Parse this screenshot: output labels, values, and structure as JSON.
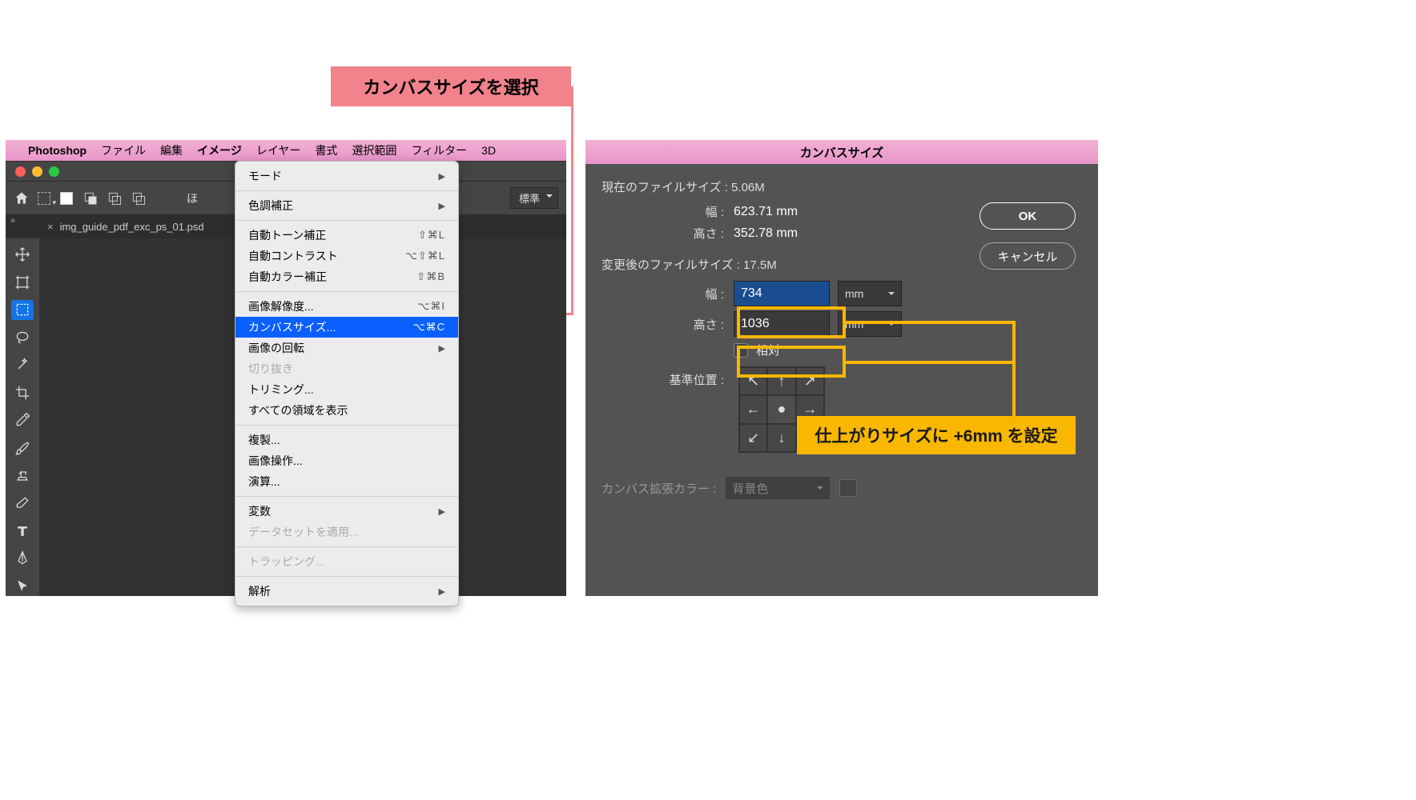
{
  "callouts": {
    "top": "カンバスサイズを選択",
    "yellow": "仕上がりサイズに +6mm を設定"
  },
  "menubar": {
    "apple": "",
    "app": "Photoshop",
    "items": [
      "ファイル",
      "編集",
      "イメージ",
      "レイヤー",
      "書式",
      "選択範囲",
      "フィルター",
      "3D"
    ]
  },
  "toolbar": {
    "std_label": "標準",
    "other": "ほ"
  },
  "document_tab": "img_guide_pdf_exc_ps_01.psd",
  "tab_close": "×",
  "collapse": "»",
  "menu": {
    "items": [
      {
        "label": "モード",
        "sub": true
      },
      null,
      {
        "label": "色調補正",
        "sub": true
      },
      null,
      {
        "label": "自動トーン補正",
        "shortcut": "⇧⌘L"
      },
      {
        "label": "自動コントラスト",
        "shortcut": "⌥⇧⌘L"
      },
      {
        "label": "自動カラー補正",
        "shortcut": "⇧⌘B"
      },
      null,
      {
        "label": "画像解像度...",
        "shortcut": "⌥⌘I"
      },
      {
        "label": "カンバスサイズ...",
        "shortcut": "⌥⌘C",
        "highlight": true
      },
      {
        "label": "画像の回転",
        "sub": true
      },
      {
        "label": "切り抜き",
        "disabled": true
      },
      {
        "label": "トリミング..."
      },
      {
        "label": "すべての領域を表示"
      },
      null,
      {
        "label": "複製..."
      },
      {
        "label": "画像操作..."
      },
      {
        "label": "演算..."
      },
      null,
      {
        "label": "変数",
        "sub": true
      },
      {
        "label": "データセットを適用...",
        "disabled": true
      },
      null,
      {
        "label": "トラッピング...",
        "disabled": true
      },
      null,
      {
        "label": "解析",
        "sub": true
      }
    ]
  },
  "dialog": {
    "title": "カンバスサイズ",
    "current_label": "現在のファイルサイズ : 5.06M",
    "cur_w_lbl": "幅 :",
    "cur_w": "623.71 mm",
    "cur_h_lbl": "高さ :",
    "cur_h": "352.78 mm",
    "new_label": "変更後のファイルサイズ : 17.5M",
    "w_lbl": "幅 :",
    "w_val": "734",
    "w_unit": "mm",
    "h_lbl": "高さ :",
    "h_val": "1036",
    "h_unit": "mm",
    "relative": "相対",
    "anchor_lbl": "基準位置 :",
    "ext_lbl": "カンバス拡張カラー :",
    "ext_val": "背景色",
    "ok": "OK",
    "cancel": "キャンセル"
  }
}
